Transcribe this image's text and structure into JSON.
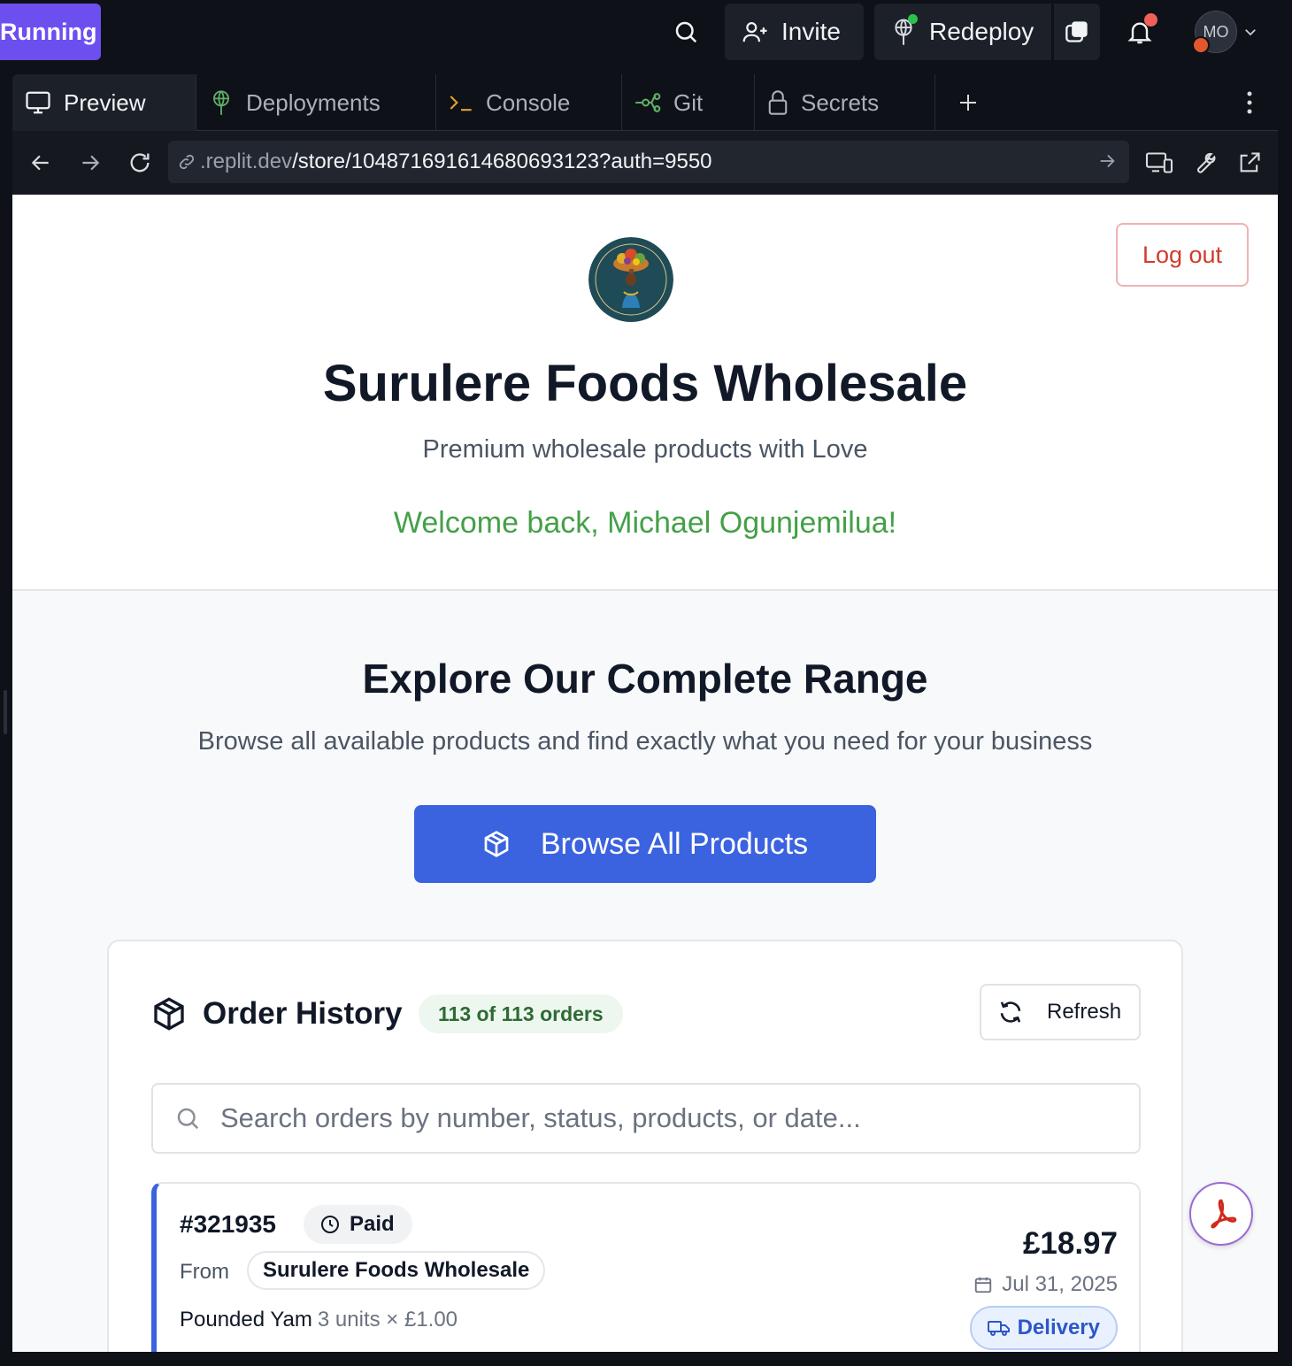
{
  "topbar": {
    "run_status": "Running",
    "invite_label": "Invite",
    "redeploy_label": "Redeploy",
    "avatar_initials": "MO"
  },
  "tabs": [
    {
      "label": "Preview",
      "icon": "monitor-icon",
      "active": true
    },
    {
      "label": "Deployments",
      "icon": "deployments-icon",
      "active": false
    },
    {
      "label": "Console",
      "icon": "terminal-icon",
      "active": false
    },
    {
      "label": "Git",
      "icon": "git-icon",
      "active": false
    },
    {
      "label": "Secrets",
      "icon": "lock-icon",
      "active": false
    }
  ],
  "urlbar": {
    "url_host": ".replit.dev",
    "url_path": "/store/1048716916146806931​23?auth=9550"
  },
  "store": {
    "logout_label": "Log out",
    "title": "Surulere Foods Wholesale",
    "subtitle": "Premium wholesale products with Love",
    "welcome": "Welcome back, Michael Ogunjemilua!",
    "explore_title": "Explore Our Complete Range",
    "explore_subtitle": "Browse all available products and find exactly what you need for your business",
    "browse_label": "Browse All Products"
  },
  "order_history": {
    "title": "Order History",
    "count_label": "113 of 113 orders",
    "refresh_label": "Refresh",
    "search_placeholder": "Search orders by number, status, products, or date...",
    "orders": [
      {
        "number": "#321935",
        "status": "Paid",
        "from_label": "From",
        "from": "Surulere Foods Wholesale",
        "item_name": "Pounded Yam",
        "item_qty": "3 units × £1.00",
        "total": "£18.97",
        "date": "Jul 31, 2025",
        "fulfilment": "Delivery"
      }
    ]
  },
  "colors": {
    "accent": "#3b63e0",
    "run_pill": "#6d4ff0",
    "welcome_green": "#43a047",
    "logout_red": "#d23a2b"
  }
}
